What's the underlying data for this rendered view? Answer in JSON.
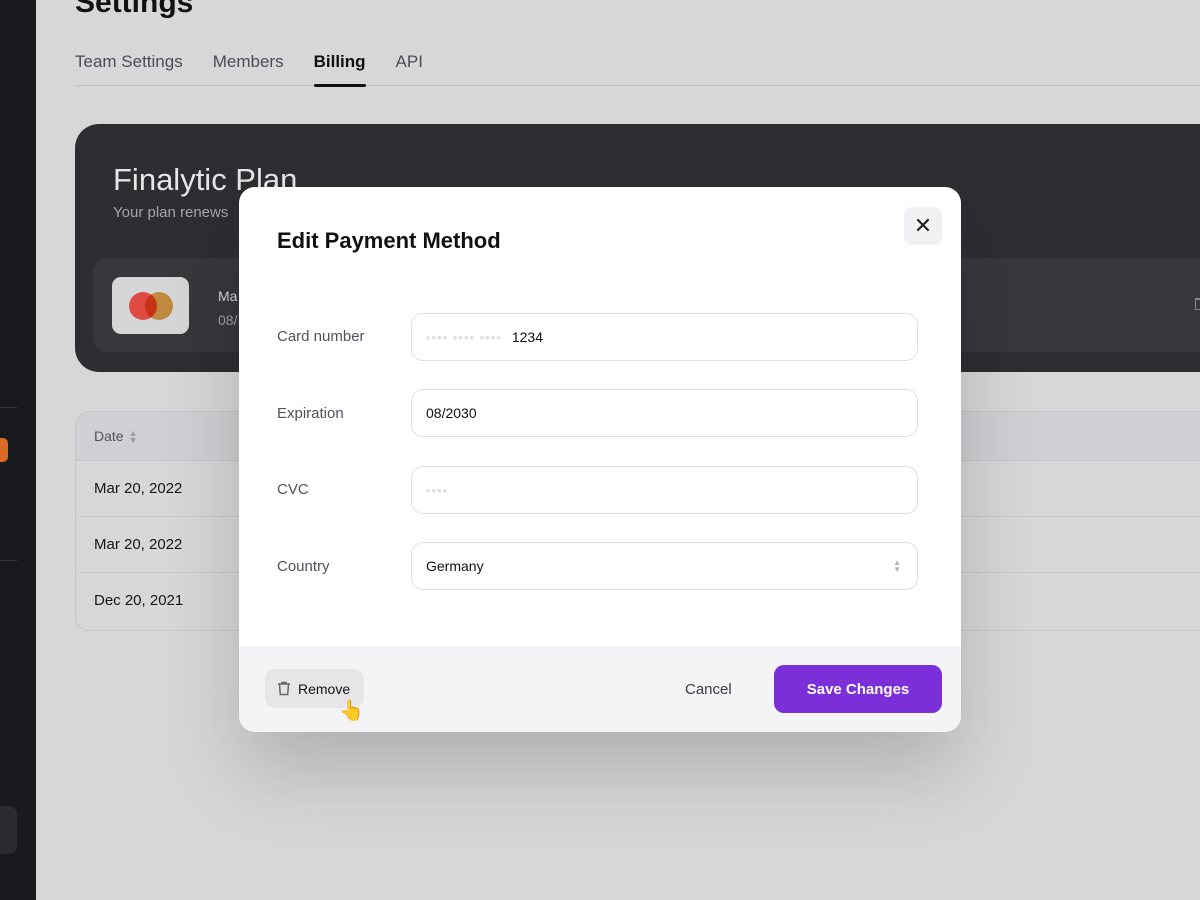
{
  "page": {
    "title": "Settings",
    "tabs": [
      {
        "label": "Team Settings"
      },
      {
        "label": "Members"
      },
      {
        "label": "Billing",
        "active": true
      },
      {
        "label": "API"
      }
    ]
  },
  "plan": {
    "name": "Finalytic Plan",
    "subtitle": "Your plan renews",
    "payment_method": {
      "brand_icon": "mastercard-icon",
      "name": "Ma",
      "expiry": "08/"
    }
  },
  "table": {
    "headers": [
      "Date"
    ],
    "rows": [
      {
        "date": "Mar 20, 2022"
      },
      {
        "date": "Mar 20, 2022"
      },
      {
        "date": "Dec 20, 2021"
      }
    ]
  },
  "modal": {
    "title": "Edit Payment Method",
    "fields": {
      "card_number": {
        "label": "Card number",
        "mask": "•••• •••• ••••",
        "value": "1234"
      },
      "expiration": {
        "label": "Expiration",
        "value": "08/2030"
      },
      "cvc": {
        "label": "CVC",
        "mask": "••••"
      },
      "country": {
        "label": "Country",
        "value": "Germany"
      }
    },
    "remove_label": "Remove",
    "cancel_label": "Cancel",
    "save_label": "Save Changes"
  },
  "colors": {
    "accent": "#7a2fd9",
    "sidebar_badge": "#d86a24"
  }
}
